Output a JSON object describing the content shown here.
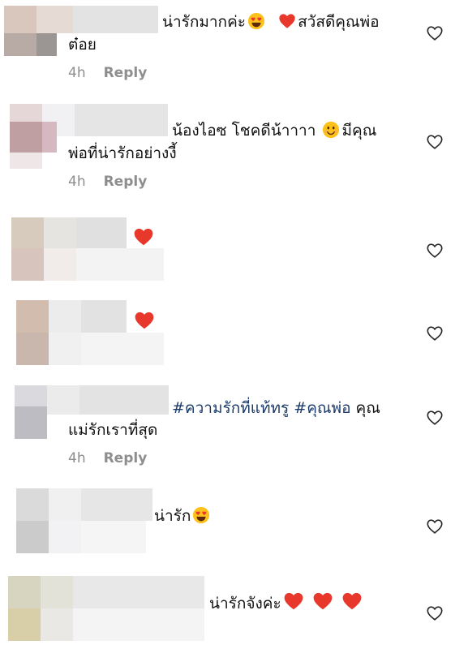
{
  "comments": [
    {
      "text": "น่ารักมากค่ะ",
      "text_after": "สวัสดีคุณพ่อ",
      "text_line2": "ต๋อย",
      "time": "4h",
      "reply": "Reply"
    },
    {
      "text": "น้องไอซ  โชคดีน้าาาา",
      "text_after": "มีคุณ",
      "text_line2": "พ่อที่น่ารักอย่างงี้",
      "time": "4h",
      "reply": "Reply"
    },
    {
      "text": ""
    },
    {
      "text": ""
    },
    {
      "tag1": "#ความรักที่แท้ทรู",
      "tag2": "#คุณพ่อ",
      "text_after": "คุณ",
      "text_line2": "แม่รักเราที่สุด",
      "time": "4h",
      "reply": "Reply"
    },
    {
      "text": "น่ารัก"
    },
    {
      "text": "น่ารักจังค่ะ"
    }
  ],
  "icons": {
    "like": "heart-outline-icon",
    "emoji_heart": "red-heart-emoji",
    "emoji_hearteyes": "heart-eyes-emoji",
    "emoji_smile": "smiling-face-emoji"
  },
  "colors": {
    "hashtag": "#1a3a6b",
    "meta": "#8e8e8e",
    "heart": "#e8372b"
  }
}
